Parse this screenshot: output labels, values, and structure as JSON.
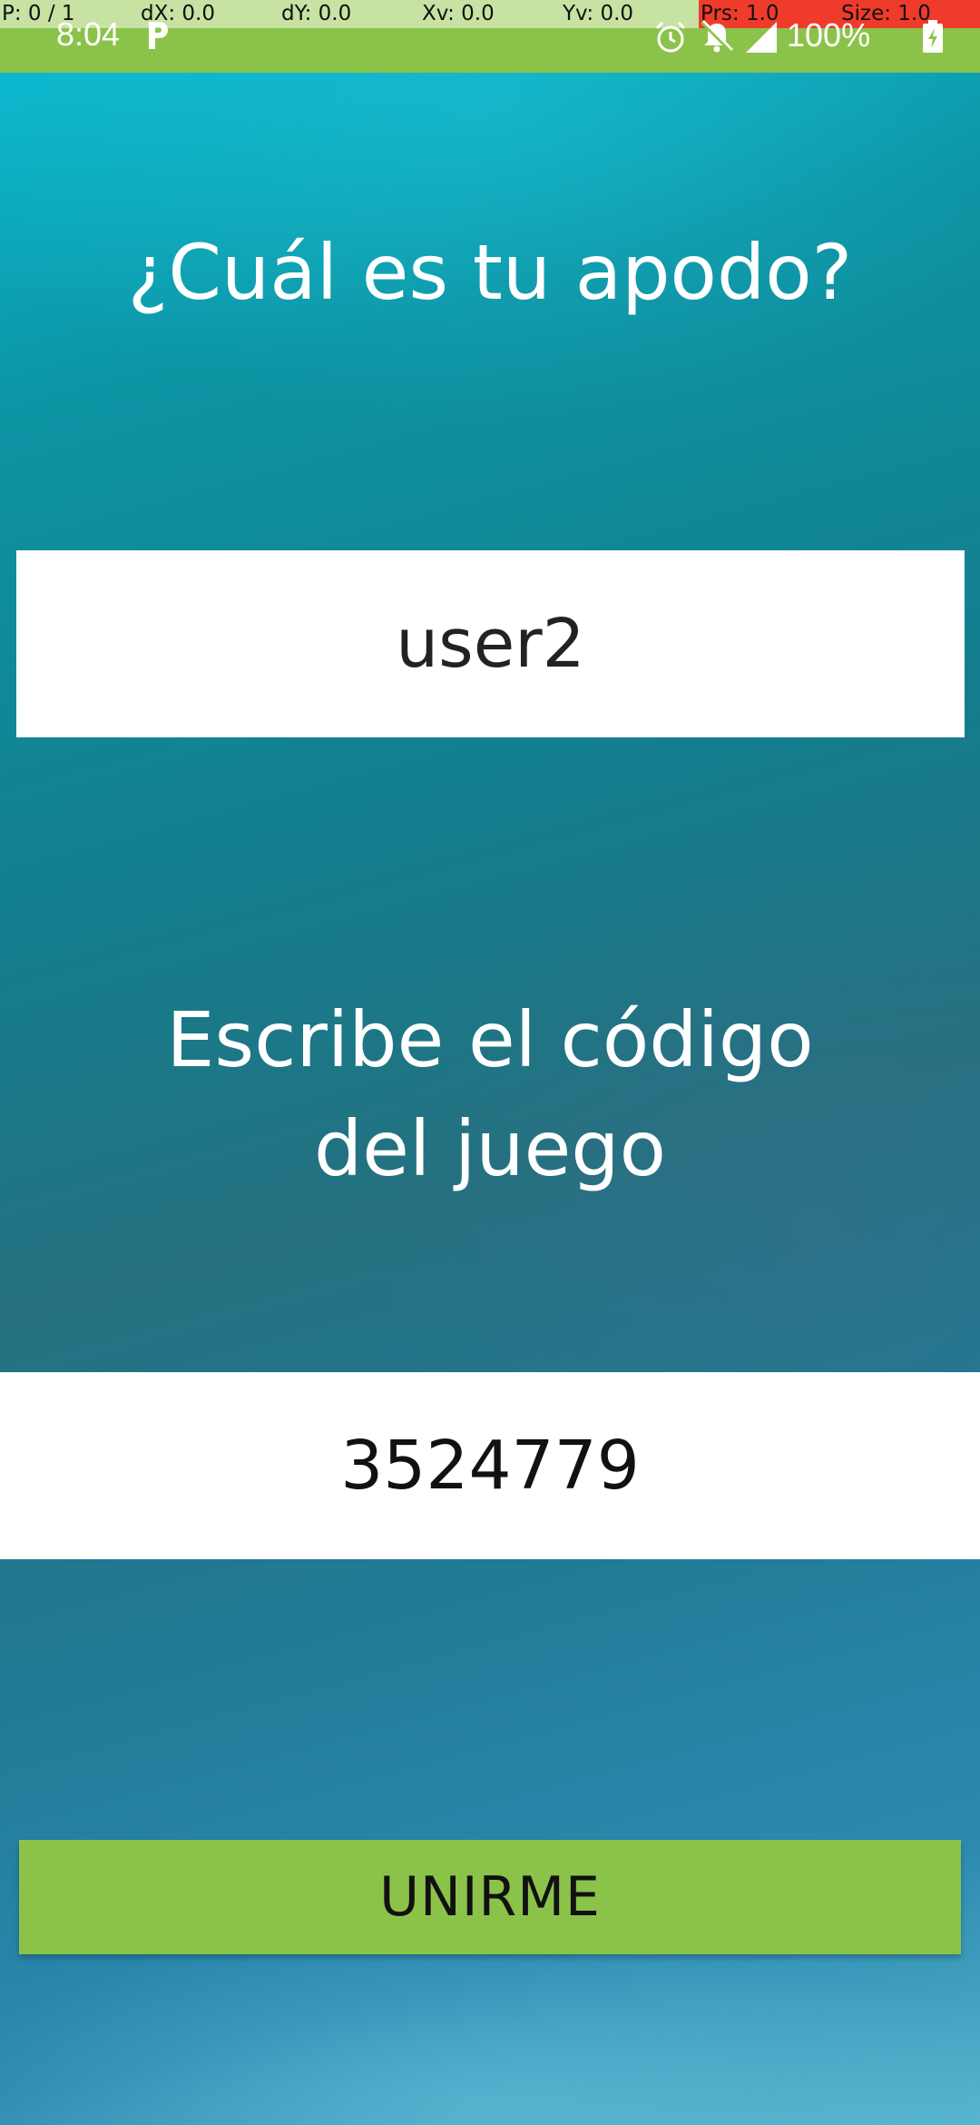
{
  "status_bar": {
    "debug": {
      "pointer": "P: 0 / 1",
      "dx": "dX: 0.0",
      "dy": "dY: 0.0",
      "xv": "Xv: 0.0",
      "yv": "Yv: 0.0",
      "prs": "Prs: 1.0",
      "size": "Size: 1.0"
    },
    "time": "8:04",
    "battery_percent": "100%",
    "icons": [
      "p-app-icon",
      "alarm-icon",
      "bell-off-icon",
      "signal-icon",
      "battery-charging-icon"
    ],
    "color": "#8bc34a"
  },
  "main": {
    "nickname_prompt": "¿Cuál es tu apodo?",
    "nickname_value": "user2",
    "code_prompt": "Escribe el código del juego",
    "code_value": "3524779",
    "join_label": "UNIRME"
  },
  "colors": {
    "accent": "#8bc34a",
    "background_top": "#0bbfd6",
    "background_mid": "#137f8f",
    "field_background": "#ffffff"
  }
}
